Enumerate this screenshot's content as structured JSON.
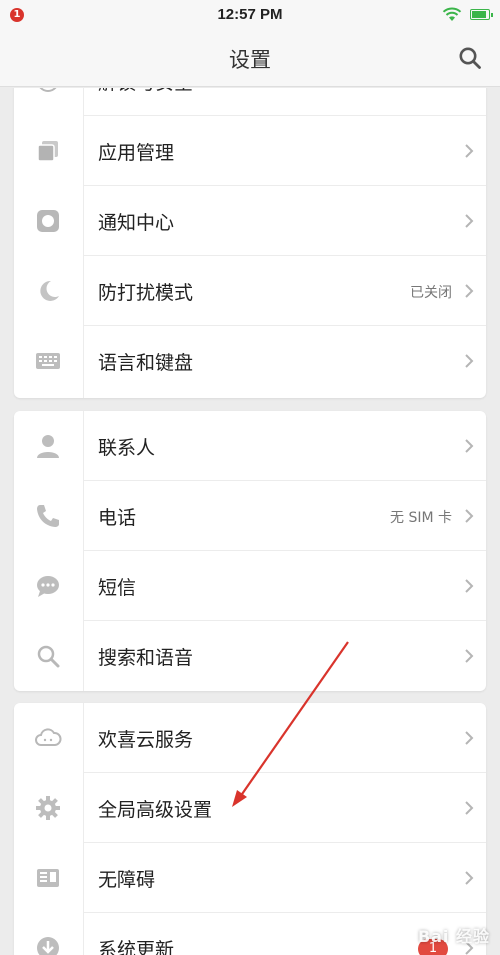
{
  "status_bar": {
    "notification_count": "1",
    "time": "12:57 PM",
    "battery_level": 0.9
  },
  "header": {
    "title": "设置",
    "search_icon": "search-icon"
  },
  "groups": [
    {
      "items": [
        {
          "label": "解锁与安全",
          "icon": "fingerprint-icon",
          "value": ""
        },
        {
          "label": "应用管理",
          "icon": "app-manage-icon",
          "value": ""
        },
        {
          "label": "通知中心",
          "icon": "notification-icon",
          "value": ""
        },
        {
          "label": "防打扰模式",
          "icon": "moon-icon",
          "value": "已关闭"
        },
        {
          "label": "语言和键盘",
          "icon": "keyboard-icon",
          "value": ""
        }
      ]
    },
    {
      "items": [
        {
          "label": "联系人",
          "icon": "contact-icon",
          "value": ""
        },
        {
          "label": "电话",
          "icon": "phone-icon",
          "value": "无 SIM 卡"
        },
        {
          "label": "短信",
          "icon": "message-icon",
          "value": ""
        },
        {
          "label": "搜索和语音",
          "icon": "search-icon",
          "value": ""
        }
      ]
    },
    {
      "items": [
        {
          "label": "欢喜云服务",
          "icon": "cloud-icon",
          "value": ""
        },
        {
          "label": "全局高级设置",
          "icon": "gear-icon",
          "value": ""
        },
        {
          "label": "无障碍",
          "icon": "accessibility-icon",
          "value": ""
        },
        {
          "label": "系统更新",
          "icon": "download-icon",
          "value": "",
          "badge": "1"
        }
      ]
    }
  ],
  "watermark": "Bai 经验",
  "colors": {
    "annotation_arrow": "#d9342c",
    "badge": "#e24a40",
    "icon_gray": "#b8b8b8"
  }
}
